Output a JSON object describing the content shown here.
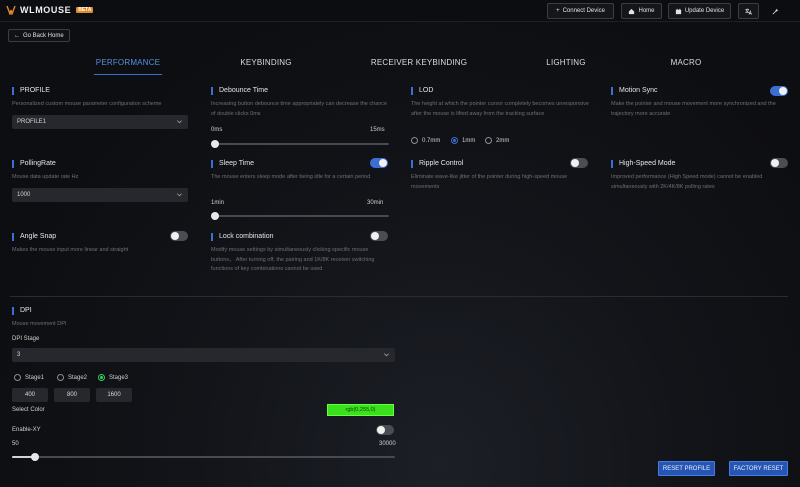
{
  "colors": {
    "accent": "#3b6fd1",
    "color_swatch": "#39e21a"
  },
  "app": {
    "logo_text": "WLMOUSE",
    "logo_badge": "BETA"
  },
  "topbar": {
    "connect": "Connect Device",
    "home": "Home",
    "update": "Update Device",
    "translate_icon": "translate-icon",
    "theme_icon": "wand-icon"
  },
  "back": {
    "label": "Go Back Home"
  },
  "tabs": [
    "PERFORMANCE",
    "KEYBINDING",
    "RECEIVER KEYBINDING",
    "LIGHTING",
    "MACRO"
  ],
  "active_tab": "PERFORMANCE",
  "profile": {
    "title": "PROFILE",
    "desc": "Personalized custom mouse parameter configuration scheme",
    "value": "PROFILE1"
  },
  "debounce": {
    "title": "Debounce Time",
    "desc": "Increasing button debounce time appropriately can decrease the chance of double clicks 0ms",
    "min": "0ms",
    "max": "15ms",
    "value": 0
  },
  "lod": {
    "title": "LOD",
    "desc": "The height at which the pointer cursor completely becomes unresponsive after the mouse is lifted away from the tracking surface",
    "options": [
      "0.7mm",
      "1mm",
      "2mm"
    ],
    "selected": "1mm"
  },
  "motion_sync": {
    "title": "Motion Sync",
    "desc": "Make the pointer and mouse movement more synchronized and the trajectory more accurate",
    "on": true
  },
  "polling": {
    "title": "PollingRate",
    "desc": "Mouse data update rate Hz",
    "value": "1000"
  },
  "sleep": {
    "title": "Sleep Time",
    "desc": "The mouse enters sleep mode after being idle for a certain period",
    "min": "1min",
    "max": "30min",
    "value": 0,
    "on": true
  },
  "ripple": {
    "title": "Ripple Control",
    "desc": "Eliminate wave-like jitter of the pointer during high-speed mouse movements",
    "on": false
  },
  "highspeed": {
    "title": "High-Speed Mode",
    "desc": "Improved performance (High Speed mode) cannot be enabled simultaneously with 2K/4K/8K polling rates",
    "on": false
  },
  "angle": {
    "title": "Angle Snap",
    "desc": "Makes the mouse input more linear and straight",
    "on": false
  },
  "lock": {
    "title": "Lock combination",
    "desc": "Modify mouse settings by simultaneously clicking specific mouse buttons， After turning off, the pairing and 1K/8K receiver switching functions of key combinations cannot be used",
    "on": false
  },
  "dpi": {
    "title": "DPI",
    "desc": "Mouse movement DPI",
    "stage_label": "DPI Stage",
    "stage_value": "3",
    "stages": [
      {
        "label": "Stage1",
        "value": "400"
      },
      {
        "label": "Stage2",
        "value": "800"
      },
      {
        "label": "Stage3",
        "value": "1600"
      }
    ],
    "selected_stage": "Stage3",
    "select_color_label": "Select Color",
    "color_value": "rgb(0,255,0)",
    "enable_xy_label": "Enable-XY",
    "enable_xy_on": false,
    "slider_min": "50",
    "slider_max": "30000",
    "slider_fraction": 0.06
  },
  "buttons": {
    "reset_profile": "RESET PROFILE",
    "factory_reset": "FACTORY RESET"
  }
}
